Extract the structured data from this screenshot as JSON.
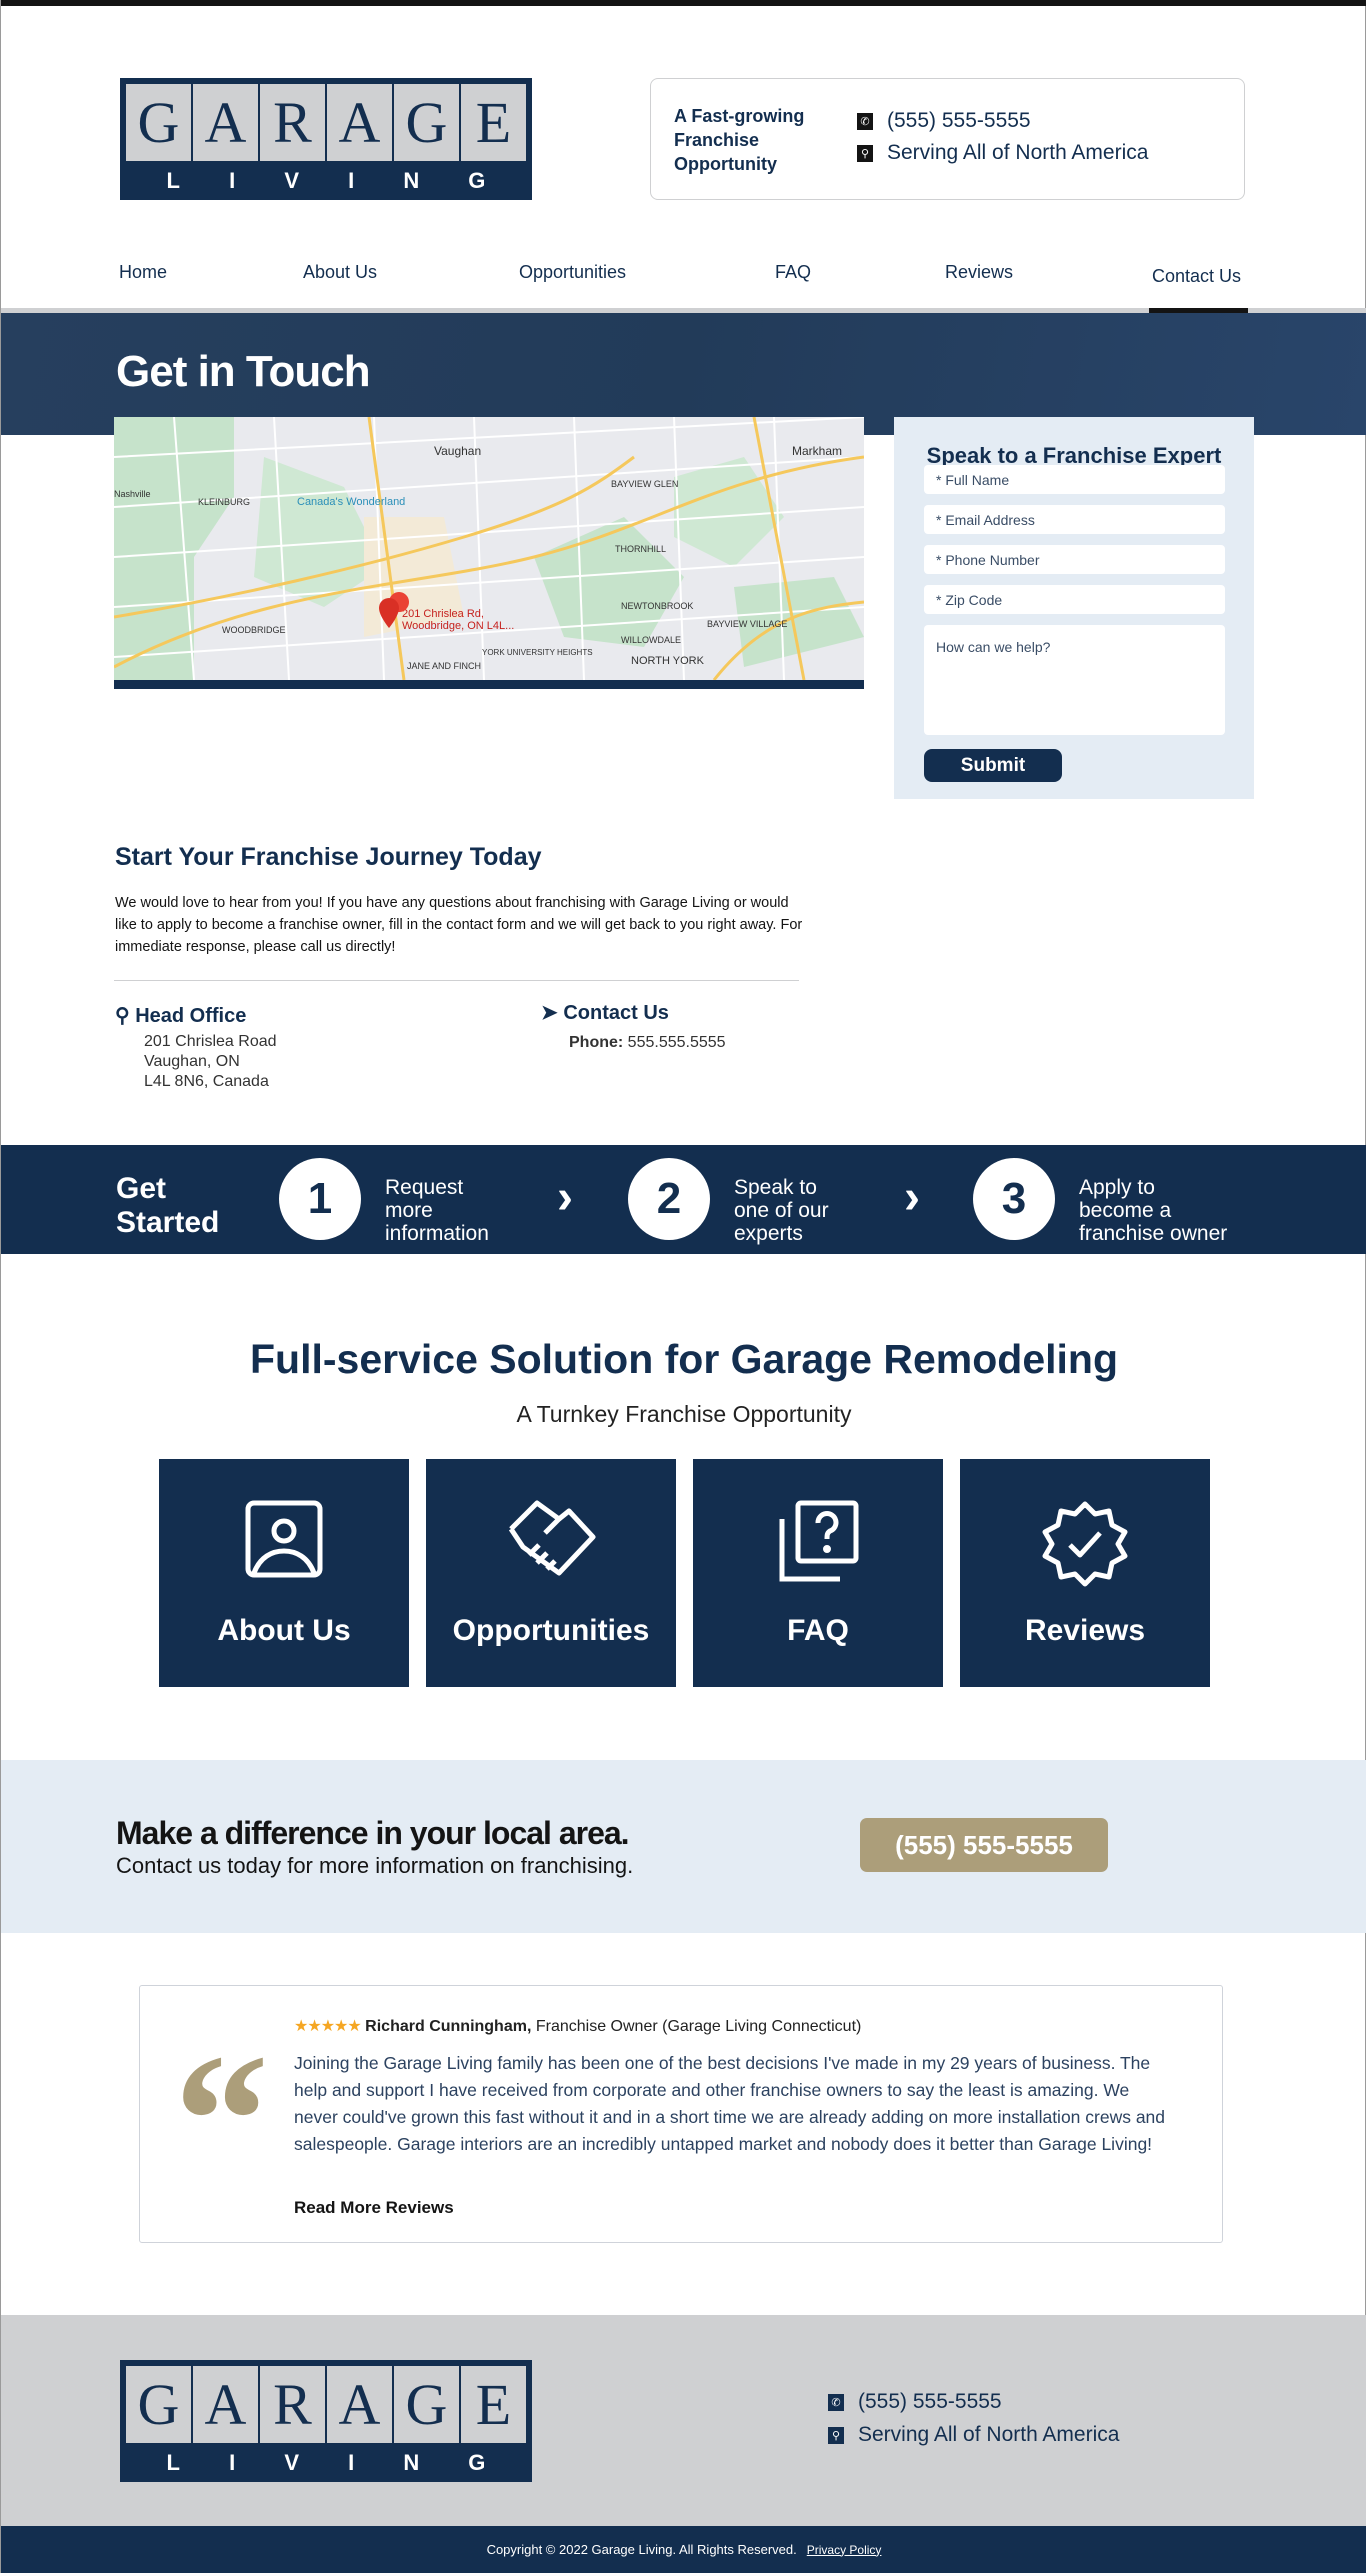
{
  "colors": {
    "navy": "#132e4f",
    "hero": "#243f5e",
    "light": "#e4ecf4",
    "tan": "#ac9e7a",
    "gray": "#cfd0d2"
  },
  "logo": {
    "letters": [
      "G",
      "A",
      "R",
      "A",
      "G",
      "E"
    ],
    "sub": [
      "L",
      "I",
      "V",
      "I",
      "N",
      "G"
    ]
  },
  "header": {
    "tagline": "A Fast-growing Franchise Opportunity",
    "phone": "(555) 555-5555",
    "service": "Serving All of North America",
    "phone_icon": "phone-icon",
    "location_icon": "map-pin-icon"
  },
  "nav": {
    "items": [
      {
        "label": "Home"
      },
      {
        "label": "About Us"
      },
      {
        "label": "Opportunities"
      },
      {
        "label": "FAQ"
      },
      {
        "label": "Reviews"
      },
      {
        "label": "Contact Us",
        "active": true
      }
    ]
  },
  "hero": {
    "title": "Get in Touch"
  },
  "map": {
    "pin_label_1": "201 Chrislea Rd,",
    "pin_label_2": "Woodbridge, ON L4L...",
    "labels": [
      "Vaughan",
      "Markham",
      "Nashville",
      "KLEINBURG",
      "Canada's Wonderland",
      "BAYVIEW GLEN",
      "THORNHILL",
      "NEWTONBROOK",
      "BAYVIEW VILLAGE",
      "WILLOWDALE",
      "NORTH YORK",
      "WOODBRIDGE",
      "YORK UNIVERSITY HEIGHTS",
      "JANE AND FINCH"
    ]
  },
  "form": {
    "title": "Speak to a Franchise Expert",
    "full_name": "* Full Name",
    "email": "* Email Address",
    "phone": "* Phone Number",
    "zip": "* Zip Code",
    "message": "How can we help?",
    "submit": "Submit"
  },
  "intro": {
    "title": "Start Your Franchise Journey Today",
    "body": "We would love to hear from you! If you have any questions about franchising with Garage Living or would like to apply to become a franchise owner, fill in the contact form and we will get back to you right away. For immediate response, please call us directly!"
  },
  "office": {
    "title": "Head Office",
    "line1": "201 Chrislea Road",
    "line2": "Vaughan, ON",
    "line3": "L4L 8N6, Canada"
  },
  "contact": {
    "title": "Contact Us",
    "phone_label": "Phone:",
    "phone": "555.555.5555"
  },
  "steps": {
    "title_1": "Get",
    "title_2": "Started",
    "items": [
      {
        "num": "1",
        "l1": "Request",
        "l2": "more",
        "l3": "information"
      },
      {
        "num": "2",
        "l1": "Speak to",
        "l2": "one of our",
        "l3": "experts"
      },
      {
        "num": "3",
        "l1": "Apply to",
        "l2": "become a",
        "l3": "franchise owner"
      }
    ]
  },
  "solution": {
    "title": "Full-service Solution for Garage Remodeling",
    "subtitle": "A Turnkey Franchise Opportunity",
    "tiles": [
      {
        "label": "About Us",
        "icon": "profile-icon"
      },
      {
        "label": "Opportunities",
        "icon": "handshake-icon"
      },
      {
        "label": "FAQ",
        "icon": "question-icon"
      },
      {
        "label": "Reviews",
        "icon": "badge-check-icon"
      }
    ]
  },
  "cta": {
    "title": "Make a difference in your local area.",
    "subtitle": "Contact us today for more information on franchising.",
    "button": "(555) 555-5555"
  },
  "review": {
    "rating": 5,
    "name": "Richard Cunningham,",
    "role": "Franchise Owner (Garage Living Connecticut)",
    "text": "Joining the Garage Living family has been one of the best decisions I've made in my 29 years of business. The help and support I have received from corporate and other franchise owners to say the least is amazing. We never could've grown this fast without it and in a short time we are already adding on more installation crews and salespeople. Garage interiors are an incredibly untapped market and nobody does it better than Garage Living!",
    "link": "Read More Reviews"
  },
  "footer": {
    "phone": "(555) 555-5555",
    "service": "Serving All of North America",
    "copyright": "Copyright © 2022 Garage Living. All Rights Reserved.",
    "privacy": "Privacy Policy"
  }
}
